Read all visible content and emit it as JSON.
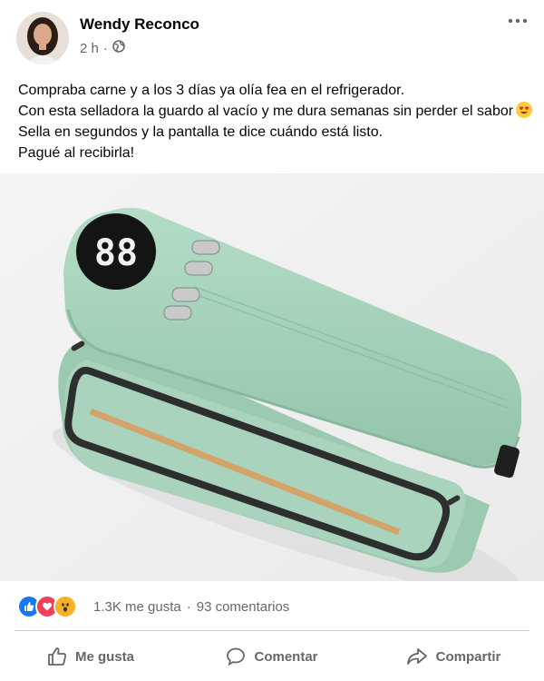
{
  "post": {
    "author": "Wendy Reconco",
    "time": "2 h",
    "separator": "·",
    "lines": [
      "Compraba carne y a los 3 días ya olía fea en el refrigerador.",
      "Con esta selladora la guardo al vacío y me dura semanas sin perder el sabor",
      "Sella en segundos y la pantalla te dice cuándo está listo.",
      "Pagué al recibirla!"
    ],
    "emoji": "heart-eyes-emoji",
    "privacy_icon": "globe-icon",
    "menu_icon": "more-icon"
  },
  "image": {
    "display": "88"
  },
  "stats": {
    "likes": "1.3K me gusta",
    "separator": "·",
    "comments": "93 comentarios",
    "reactions": [
      "like",
      "love",
      "wow"
    ]
  },
  "actions": {
    "like": "Me gusta",
    "comment": "Comentar",
    "share": "Compartir"
  },
  "colors": {
    "like_blue": "#1877f2",
    "love_red": "#f33e58",
    "wow_yellow": "#f7b125",
    "device_green": "#a8d3bd"
  }
}
